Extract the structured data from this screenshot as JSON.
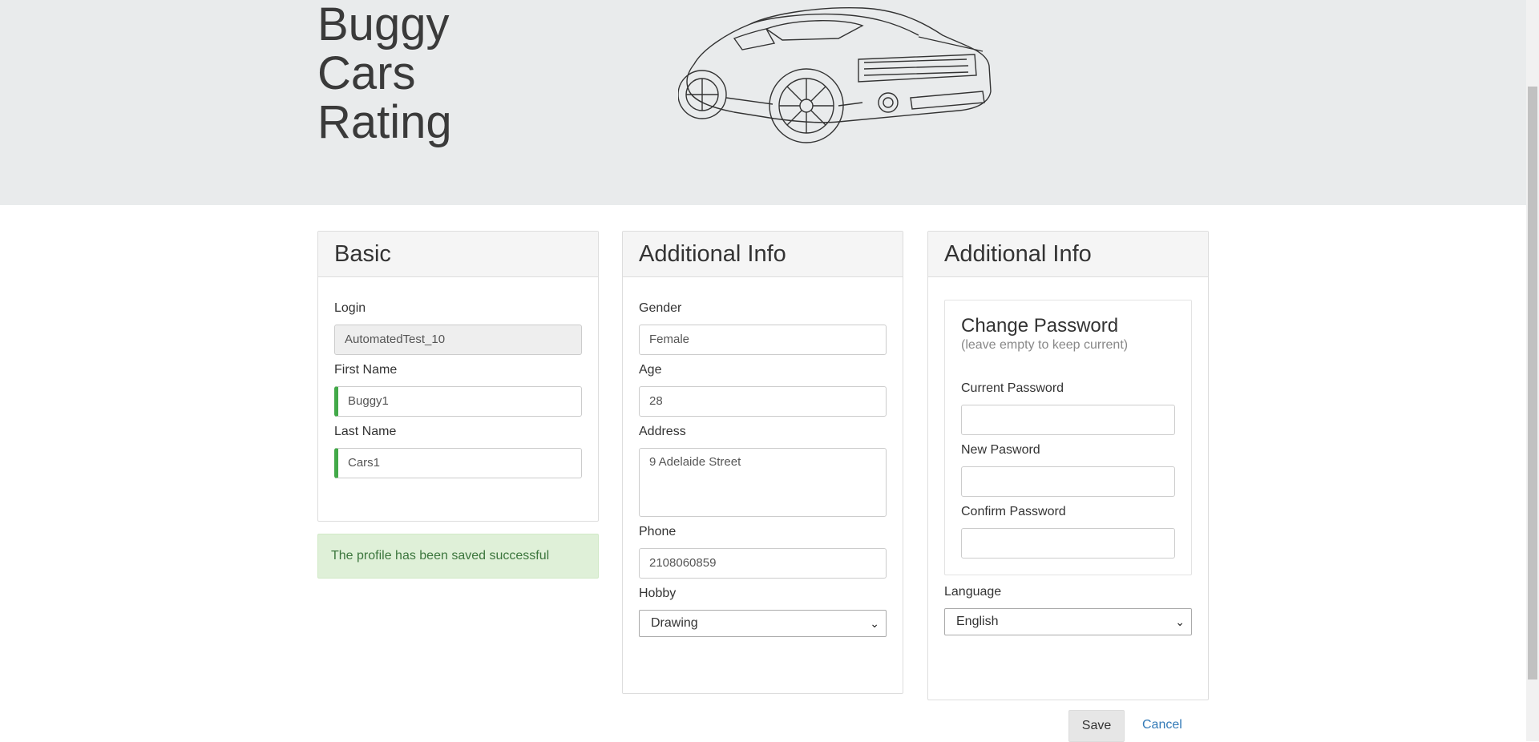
{
  "header": {
    "brand": "Buggy\nCars\nRating"
  },
  "basic": {
    "title": "Basic",
    "login_label": "Login",
    "login_value": "AutomatedTest_10",
    "first_name_label": "First Name",
    "first_name_value": "Buggy1",
    "last_name_label": "Last Name",
    "last_name_value": "Cars1"
  },
  "alert": {
    "message": "The profile has been saved successful"
  },
  "additional": {
    "title": "Additional Info",
    "gender_label": "Gender",
    "gender_value": "Female",
    "age_label": "Age",
    "age_value": "28",
    "address_label": "Address",
    "address_value": "9 Adelaide Street",
    "phone_label": "Phone",
    "phone_value": "2108060859",
    "hobby_label": "Hobby",
    "hobby_value": "Drawing"
  },
  "additional2": {
    "title": "Additional Info",
    "pw_title": "Change Password",
    "pw_subtitle": "(leave empty to keep current)",
    "current_password_label": "Current Password",
    "new_password_label": "New Pasword",
    "confirm_password_label": "Confirm Password",
    "language_label": "Language",
    "language_value": "English"
  },
  "actions": {
    "save_label": "Save",
    "cancel_label": "Cancel"
  },
  "icons": {
    "car": "car-illustration",
    "select_chevron": "chevron-down-icon"
  },
  "colors": {
    "header_bg": "#e9ebec",
    "valid_border": "#42a948",
    "alert_bg": "#dff0d8",
    "alert_text": "#3c763d",
    "link": "#337ab7"
  }
}
